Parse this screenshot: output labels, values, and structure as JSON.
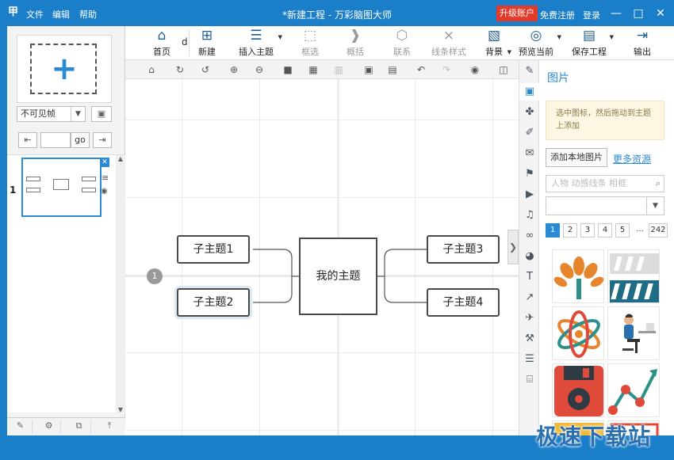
{
  "titlebar": {
    "logo": "甲",
    "menu": [
      "文件",
      "编辑",
      "帮助"
    ],
    "title": "*新建工程 - 万彩脑图大师",
    "upgrade": "升级账户",
    "register": "免费注册",
    "login": "登录",
    "minimize": "—",
    "maximize": "□",
    "close": "✕"
  },
  "left_panel": {
    "add_slide": "+",
    "frame_select": "不可见帧",
    "go_label": "go",
    "first_glyph": "⇤",
    "last_glyph": "⇥",
    "camera_glyph": "▣",
    "slide_number": "1",
    "thumb_close": "✕",
    "thumb_menu": "≡",
    "thumb_eye": "◉"
  },
  "toolbar": {
    "buttons": [
      {
        "label": "首页",
        "icon": "home-icon",
        "glyph": "⌂"
      },
      {
        "label": "新建",
        "icon": "new-icon",
        "glyph": "⊞"
      },
      {
        "label": "插入主题",
        "icon": "insert-topic-icon",
        "glyph": "☰"
      },
      {
        "label": "框选",
        "icon": "frame-select-icon",
        "glyph": "⬚"
      },
      {
        "label": "概括",
        "icon": "summary-icon",
        "glyph": "❱"
      },
      {
        "label": "联系",
        "icon": "relation-icon",
        "glyph": "⬡"
      },
      {
        "label": "线条样式",
        "icon": "line-style-icon",
        "glyph": "⨯"
      },
      {
        "label": "背景",
        "icon": "background-icon",
        "glyph": "▧"
      },
      {
        "label": "预览当前",
        "icon": "preview-icon",
        "glyph": "◎"
      },
      {
        "label": "保存工程",
        "icon": "save-icon",
        "glyph": "▤"
      },
      {
        "label": "输出",
        "icon": "export-icon",
        "glyph": "⇥"
      }
    ],
    "home_suffix": "d"
  },
  "toolbar2": {
    "glyphs": [
      "⌂",
      "↻",
      "↺",
      "⊕",
      "⊖",
      "■",
      "▦",
      "▥",
      "▣",
      "▤",
      "↶",
      "↷",
      "◉",
      "◫"
    ]
  },
  "canvas": {
    "central": "我的主题",
    "topics": [
      "子主题1",
      "子主题2",
      "子主题3",
      "子主题4"
    ],
    "badge": "1"
  },
  "iconbar": {
    "glyphs": [
      "✎",
      "▣",
      "✤",
      "✐",
      "✉",
      "⚑",
      "▶",
      "♫",
      "∞",
      "◕",
      "T",
      "↗",
      "✈",
      "⚒",
      "☰",
      "⌸"
    ],
    "toggle": "❯"
  },
  "right_panel": {
    "title": "图片",
    "hint": "选中图标，然后拖动到主题上添加",
    "add_local": "添加本地图片",
    "more": "更多资源",
    "search_placeholder": "人物 动感线条 相框",
    "pages": [
      "1",
      "2",
      "3",
      "4",
      "5",
      "...",
      "242"
    ],
    "active_page": "1"
  },
  "watermark": "极速下载站",
  "colors": {
    "chrome": "#1a7ec8",
    "accent": "#2a8ad6",
    "upgrade": "#e23b2a",
    "topic_border": "#4a4a4a"
  }
}
